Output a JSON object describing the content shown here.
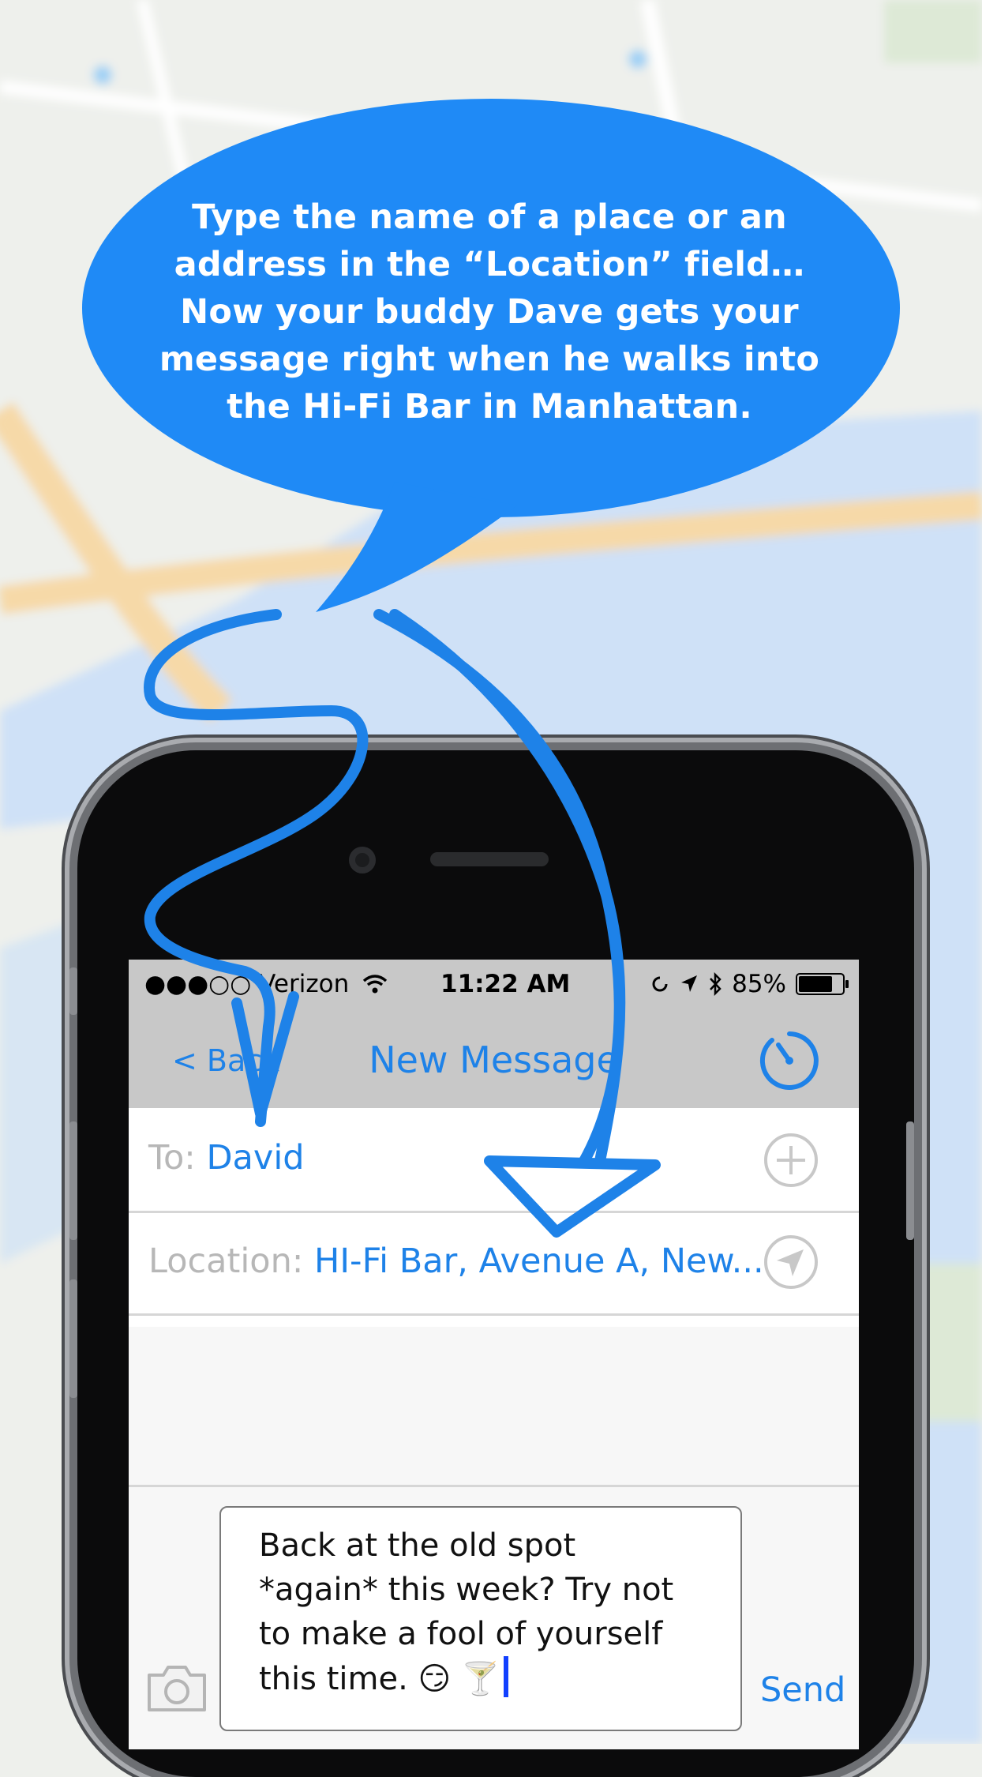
{
  "callout": {
    "text": "Type the name of a place or an address in the “Location” field… Now your buddy Dave gets your message right when he walks into the Hi-Fi Bar in Manhattan."
  },
  "status_bar": {
    "carrier": "●●●○○ Verizon",
    "time": "11:22 AM",
    "battery": "85%",
    "battery_level": 0.85
  },
  "nav": {
    "back_label": "< Back",
    "title": "New Message",
    "timer_icon": "timer-icon"
  },
  "to_row": {
    "label": "To:",
    "value": "David",
    "icon": "add-contact-icon"
  },
  "location_row": {
    "label": "Location:",
    "value": "HI-Fi Bar, Avenue A, New...",
    "icon": "location-arrow-icon"
  },
  "composer": {
    "message": "Back at the old spot\n*again* this week? Try not\nto make a fool of yourself\nthis time. 😏 🍸",
    "send_label": "Send",
    "camera_icon": "camera-icon"
  },
  "colors": {
    "accent": "#1e82e8",
    "bubble": "#1f8af6",
    "navbar": "#c8c8c8"
  }
}
